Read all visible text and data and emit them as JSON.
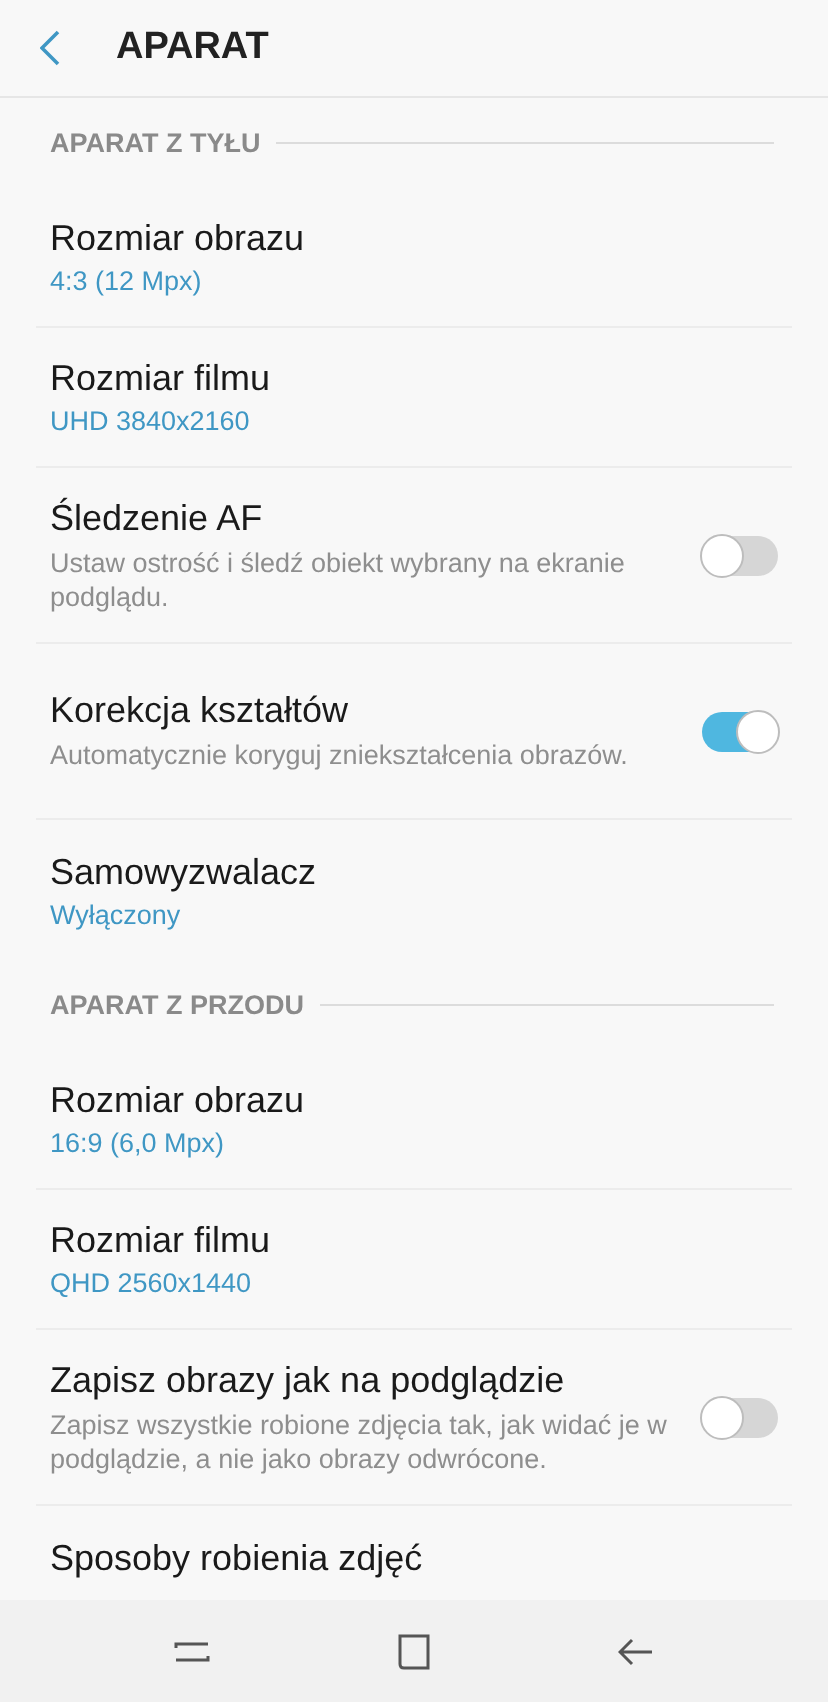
{
  "header": {
    "title": "APARAT"
  },
  "sections": [
    {
      "title": "APARAT Z TYŁU",
      "items": [
        {
          "kind": "value",
          "title": "Rozmiar obrazu",
          "value": "4:3 (12 Mpx)"
        },
        {
          "kind": "value",
          "title": "Rozmiar filmu",
          "value": "UHD 3840x2160"
        },
        {
          "kind": "switch",
          "title": "Śledzenie AF",
          "description": "Ustaw ostrość i śledź obiekt wybrany na ekranie podglądu.",
          "on": false
        },
        {
          "kind": "switch",
          "title": "Korekcja kształtów",
          "description": "Automatycznie koryguj zniekształcenia obrazów.",
          "on": true
        },
        {
          "kind": "value",
          "title": "Samowyzwalacz",
          "value": "Wyłączony"
        }
      ]
    },
    {
      "title": "APARAT Z PRZODU",
      "items": [
        {
          "kind": "value",
          "title": "Rozmiar obrazu",
          "value": "16:9 (6,0 Mpx)"
        },
        {
          "kind": "value",
          "title": "Rozmiar filmu",
          "value": "QHD 2560x1440"
        },
        {
          "kind": "switch",
          "title": "Zapisz obrazy jak na podglądzie",
          "description": "Zapisz wszystkie robione zdjęcia tak, jak widać je w podglądzie, a nie jako obrazy odwrócone.",
          "on": false
        },
        {
          "kind": "plain",
          "title": "Sposoby robienia zdjęć"
        }
      ]
    }
  ]
}
